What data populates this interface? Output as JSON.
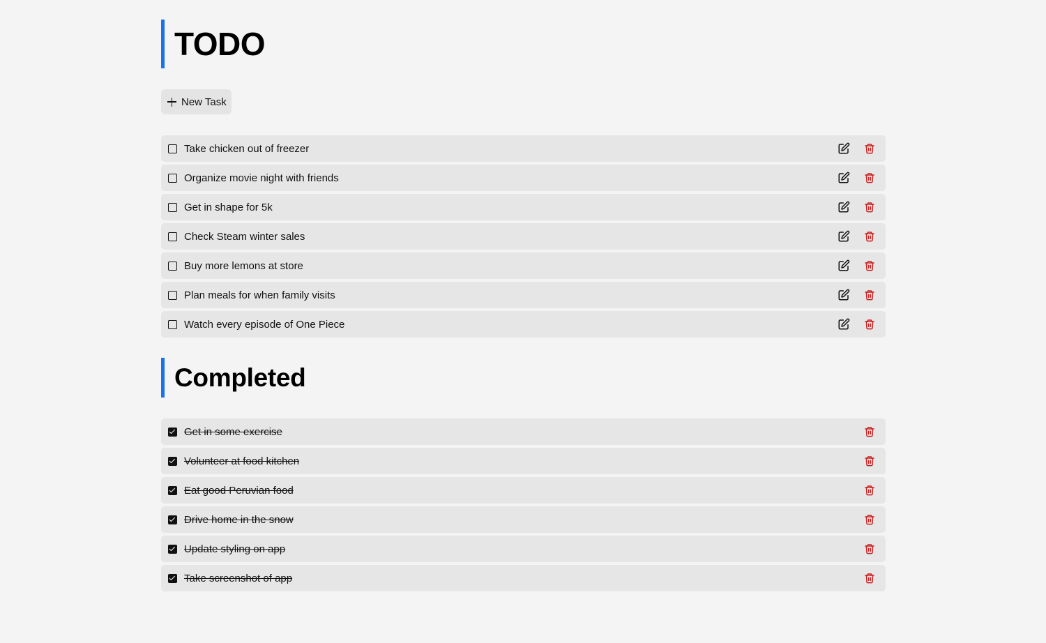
{
  "todo_section": {
    "title": "TODO",
    "new_task_label": "New Task",
    "accent_color": "#1a73e8",
    "tasks": [
      {
        "label": "Take chicken out of freezer",
        "done": false
      },
      {
        "label": "Organize movie night with friends",
        "done": false
      },
      {
        "label": "Get in shape for 5k",
        "done": false
      },
      {
        "label": "Check Steam winter sales",
        "done": false
      },
      {
        "label": "Buy more lemons at store",
        "done": false
      },
      {
        "label": "Plan meals for when family visits",
        "done": false
      },
      {
        "label": "Watch every episode of One Piece",
        "done": false
      }
    ]
  },
  "completed_section": {
    "title": "Completed",
    "tasks": [
      {
        "label": "Get in some exercise",
        "done": true
      },
      {
        "label": "Volunteer at food kitchen",
        "done": true
      },
      {
        "label": "Eat good Peruvian food",
        "done": true
      },
      {
        "label": "Drive home in the snow",
        "done": true
      },
      {
        "label": "Update styling on app",
        "done": true
      },
      {
        "label": "Take screenshot of app",
        "done": true
      }
    ]
  },
  "icons": {
    "add": "plus-icon",
    "edit": "edit-icon",
    "delete": "trash-icon",
    "unchecked": "checkbox-unchecked-icon",
    "checked": "checkbox-checked-icon"
  },
  "colors": {
    "background": "#f4f4f4",
    "row_background": "#e6e6e6",
    "accent": "#1a73e8",
    "delete": "#c81e1e"
  }
}
